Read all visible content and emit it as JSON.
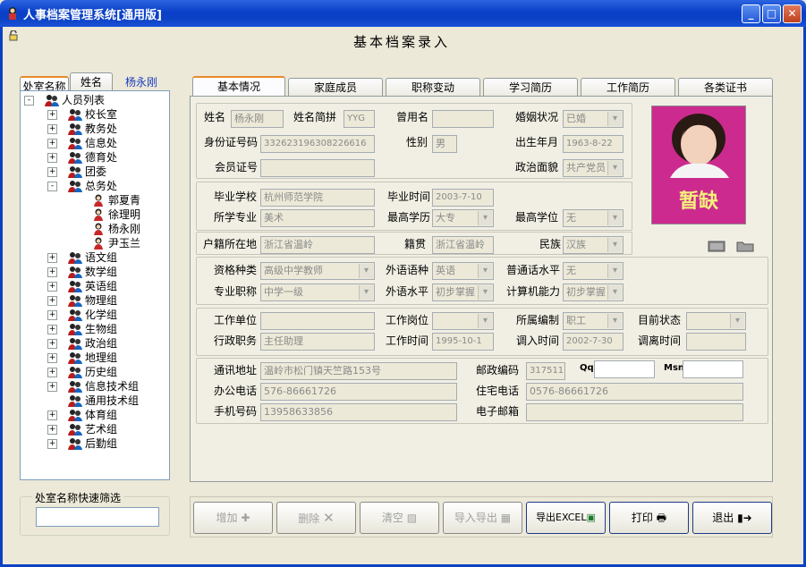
{
  "window": {
    "title": "人事档案管理系统[通用版]",
    "min": "_",
    "max": "□",
    "close": "✕"
  },
  "form_title": "基本档案录入",
  "left_tabs": [
    "处室名称",
    "姓名",
    "杨永刚"
  ],
  "tree": {
    "root": "人员列表",
    "nodes": [
      {
        "label": "校长室",
        "level": 1,
        "exp": "+"
      },
      {
        "label": "教务处",
        "level": 1,
        "exp": "+"
      },
      {
        "label": "信息处",
        "level": 1,
        "exp": "+"
      },
      {
        "label": "德育处",
        "level": 1,
        "exp": "+"
      },
      {
        "label": "团委",
        "level": 1,
        "exp": "+"
      },
      {
        "label": "总务处",
        "level": 1,
        "exp": "-"
      },
      {
        "label": "郭夏青",
        "level": 2
      },
      {
        "label": "徐理明",
        "level": 2
      },
      {
        "label": "杨永刚",
        "level": 2
      },
      {
        "label": "尹玉兰",
        "level": 2
      },
      {
        "label": "语文组",
        "level": 1,
        "exp": "+"
      },
      {
        "label": "数学组",
        "level": 1,
        "exp": "+"
      },
      {
        "label": "英语组",
        "level": 1,
        "exp": "+"
      },
      {
        "label": "物理组",
        "level": 1,
        "exp": "+"
      },
      {
        "label": "化学组",
        "level": 1,
        "exp": "+"
      },
      {
        "label": "生物组",
        "level": 1,
        "exp": "+"
      },
      {
        "label": "政治组",
        "level": 1,
        "exp": "+"
      },
      {
        "label": "地理组",
        "level": 1,
        "exp": "+"
      },
      {
        "label": "历史组",
        "level": 1,
        "exp": "+"
      },
      {
        "label": "信息技术组",
        "level": 1,
        "exp": "+"
      },
      {
        "label": "通用技术组",
        "level": 1,
        "exp": ""
      },
      {
        "label": "体育组",
        "level": 1,
        "exp": "+"
      },
      {
        "label": "艺术组",
        "level": 1,
        "exp": "+"
      },
      {
        "label": "后勤组",
        "level": 1,
        "exp": "+"
      }
    ]
  },
  "filter": {
    "label": "处室名称快速筛选",
    "value": ""
  },
  "tabs": [
    "基本情况",
    "家庭成员",
    "职称变动",
    "学习简历",
    "工作简历",
    "各类证书"
  ],
  "fields": {
    "name": {
      "label": "姓名",
      "value": "杨永刚"
    },
    "name_abbr": {
      "label": "姓名简拼",
      "value": "YYG"
    },
    "former_name": {
      "label": "曾用名",
      "value": ""
    },
    "marital": {
      "label": "婚姻状况",
      "value": "已婚"
    },
    "id_no": {
      "label": "身份证号码",
      "value": "332623196308226616"
    },
    "gender": {
      "label": "性别",
      "value": "男"
    },
    "birth": {
      "label": "出生年月",
      "value": "1963-8-22"
    },
    "member_no": {
      "label": "会员证号",
      "value": ""
    },
    "political": {
      "label": "政治面貌",
      "value": "共产党员"
    },
    "school": {
      "label": "毕业学校",
      "value": "杭州师范学院"
    },
    "grad_time": {
      "label": "毕业时间",
      "value": "2003-7-10"
    },
    "major": {
      "label": "所学专业",
      "value": "美术"
    },
    "edu": {
      "label": "最高学历",
      "value": "大专"
    },
    "degree": {
      "label": "最高学位",
      "value": "无"
    },
    "hukou": {
      "label": "户籍所在地",
      "value": "浙江省温岭"
    },
    "native": {
      "label": "籍贯",
      "value": "浙江省温岭"
    },
    "ethnic": {
      "label": "民族",
      "value": "汉族"
    },
    "qual": {
      "label": "资格种类",
      "value": "高级中学教师"
    },
    "lang": {
      "label": "外语语种",
      "value": "英语"
    },
    "mandarin": {
      "label": "普通话水平",
      "value": "无"
    },
    "title": {
      "label": "专业职称",
      "value": "中学一级"
    },
    "lang_lvl": {
      "label": "外语水平",
      "value": "初步掌握"
    },
    "computer": {
      "label": "计算机能力",
      "value": "初步掌握"
    },
    "unit": {
      "label": "工作单位",
      "value": ""
    },
    "post": {
      "label": "工作岗位",
      "value": ""
    },
    "staffing": {
      "label": "所属编制",
      "value": "职工"
    },
    "status": {
      "label": "目前状态",
      "value": ""
    },
    "admin_post": {
      "label": "行政职务",
      "value": "主任助理"
    },
    "work_time": {
      "label": "工作时间",
      "value": "1995-10-1"
    },
    "transfer_in": {
      "label": "调入时间",
      "value": "2002-7-30"
    },
    "transfer_out": {
      "label": "调离时间",
      "value": ""
    },
    "address": {
      "label": "通讯地址",
      "value": "温岭市松门镇天竺路153号"
    },
    "zip": {
      "label": "邮政编码",
      "value": "317511"
    },
    "qq": {
      "label": "Qq",
      "value": ""
    },
    "msn": {
      "label": "Msn",
      "value": ""
    },
    "office_tel": {
      "label": "办公电话",
      "value": "576-86661726"
    },
    "home_tel": {
      "label": "住宅电话",
      "value": "0576-86661726"
    },
    "mobile": {
      "label": "手机号码",
      "value": "13958633856"
    },
    "email": {
      "label": "电子邮箱",
      "value": ""
    }
  },
  "photo": {
    "caption": "暂缺"
  },
  "buttons": {
    "add": "增加",
    "delete": "删除",
    "clear": "清空",
    "import": "导入导出",
    "excel": "导出EXCEL",
    "print": "打印",
    "exit": "退出"
  },
  "colors": {
    "title_bar": "#0b41c5",
    "photo_bg": "#cc2a8e",
    "tab_accent": "#e68b2c"
  }
}
